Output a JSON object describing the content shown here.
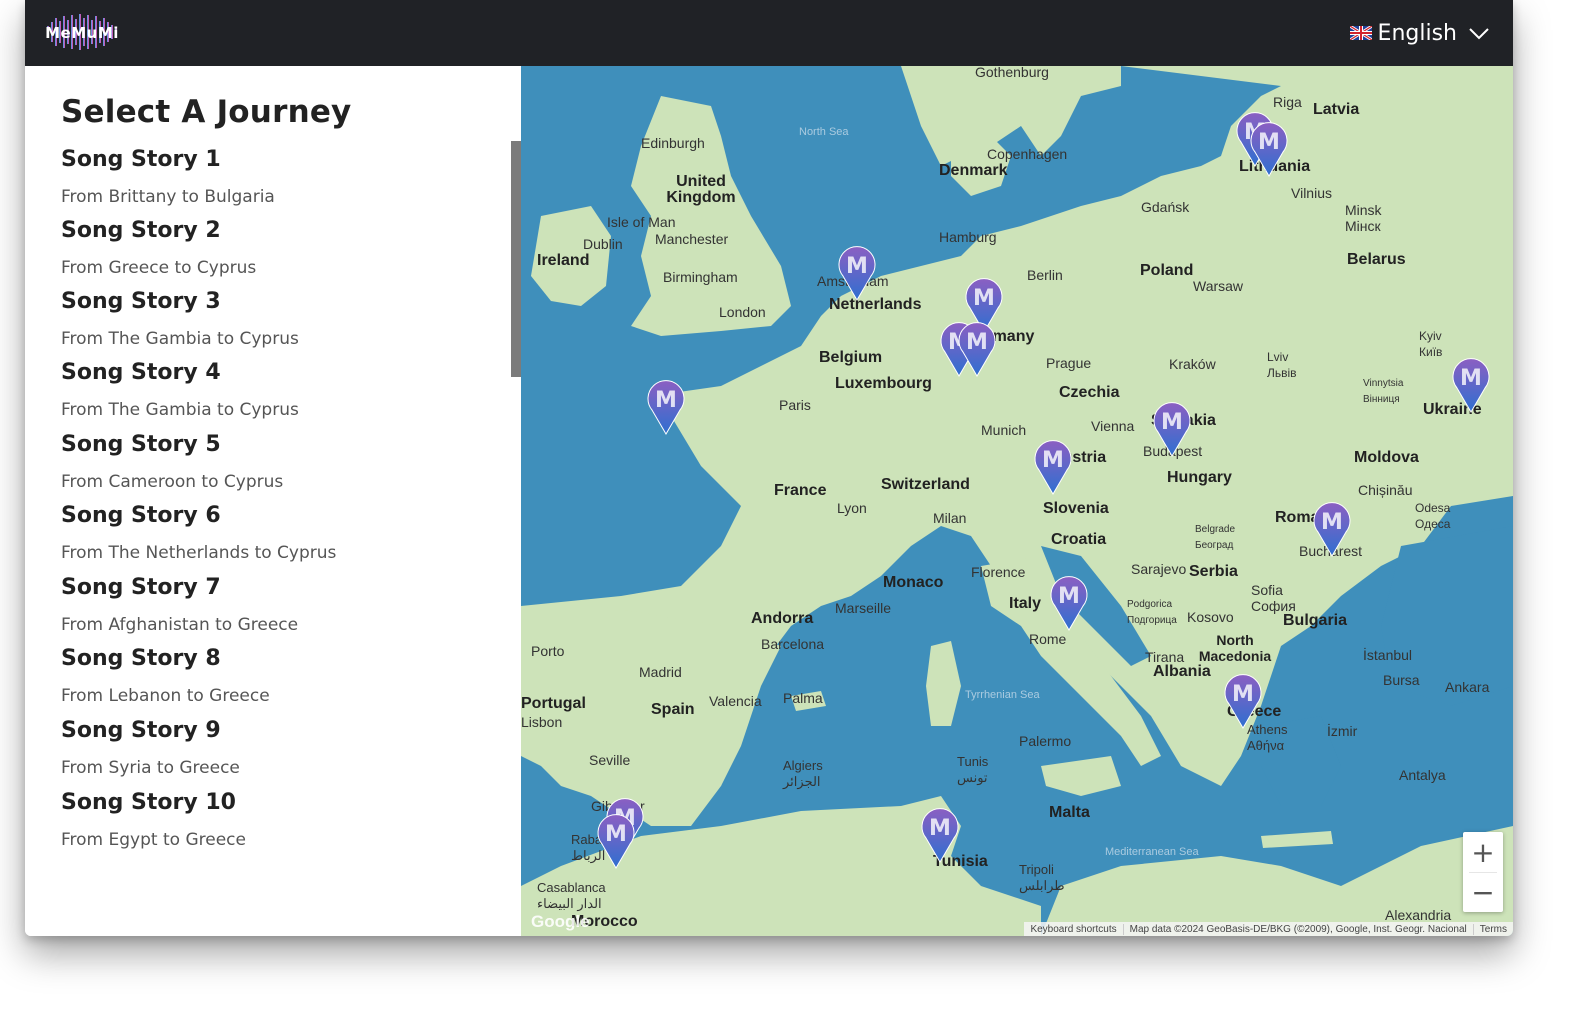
{
  "app": {
    "logo_text": "MeMuMi"
  },
  "header": {
    "language_label": "English"
  },
  "sidebar": {
    "title": "Select A Journey",
    "stories": [
      {
        "title": "Song Story 1",
        "route": "From Brittany to Bulgaria"
      },
      {
        "title": "Song Story 2",
        "route": "From Greece to Cyprus"
      },
      {
        "title": "Song Story 3",
        "route": "From The Gambia to Cyprus"
      },
      {
        "title": "Song Story 4",
        "route": "From The Gambia to Cyprus"
      },
      {
        "title": "Song Story 5",
        "route": "From Cameroon to Cyprus"
      },
      {
        "title": "Song Story 6",
        "route": "From The Netherlands to Cyprus"
      },
      {
        "title": "Song Story 7",
        "route": "From Afghanistan to Greece"
      },
      {
        "title": "Song Story 8",
        "route": "From Lebanon to Greece"
      },
      {
        "title": "Song Story 9",
        "route": "From Syria to Greece"
      },
      {
        "title": "Song Story 10",
        "route": "From Egypt to Greece"
      }
    ]
  },
  "map": {
    "marker_letter": "M",
    "labels": {
      "gothenburg": "Gothenburg",
      "riga": "Riga",
      "latvia": "Latvia",
      "north_sea": "North Sea",
      "edinburgh": "Edinburgh",
      "uk": "United Kingdom",
      "copenhagen": "Copenhagen",
      "denmark": "Denmark",
      "lithuania": "Lithuania",
      "vilnius": "Vilnius",
      "gdansk": "Gdańsk",
      "minsk": "Minsk Мінск",
      "isle_of_man": "Isle of Man",
      "dublin": "Dublin",
      "manchester": "Manchester",
      "ireland": "Ireland",
      "hamburg": "Hamburg",
      "birmingham": "Birmingham",
      "amsterdam": "Amsterdam",
      "netherlands": "Netherlands",
      "berlin": "Berlin",
      "poland": "Poland",
      "warsaw": "Warsaw",
      "belarus": "Belarus",
      "london": "London",
      "germany": "Germany",
      "belgium": "Belgium",
      "prague": "Prague",
      "krakow": "Kraków",
      "lviv": "Lviv Львів",
      "kyiv": "Kyiv Київ",
      "luxembourg": "Luxembourg",
      "czechia": "Czechia",
      "vinnytsia": "Vinnytsia Вінниця",
      "ukraine": "Ukraine",
      "paris": "Paris",
      "munich": "Munich",
      "vienna": "Vienna",
      "slovakia": "Slovakia",
      "budapest": "Budapest",
      "austria": "Austria",
      "moldova": "Moldova",
      "chisinau": "Chișinău",
      "france": "France",
      "switzerland": "Switzerland",
      "hungary": "Hungary",
      "odesa": "Odesa Одеса",
      "lyon": "Lyon",
      "milan": "Milan",
      "slovenia": "Slovenia",
      "belgrade": "Belgrade Београд",
      "romania": "Romania",
      "croatia": "Croatia",
      "bucharest": "Bucharest",
      "monaco": "Monaco",
      "florence": "Florence",
      "sarajevo": "Sarajevo",
      "serbia": "Serbia",
      "sofia": "Sofia София",
      "andorra": "Andorra",
      "marseille": "Marseille",
      "italy": "Italy",
      "podgorica": "Podgorica Подгорица",
      "kosovo": "Kosovo",
      "bulgaria": "Bulgaria",
      "barcelona": "Barcelona",
      "rome": "Rome",
      "north_macedonia": "North Macedonia",
      "istanbul": "İstanbul",
      "porto": "Porto",
      "madrid": "Madrid",
      "tirana": "Tirana",
      "albania": "Albania",
      "bursa": "Bursa",
      "ankara": "Ankara",
      "portugal": "Portugal",
      "valencia": "Valencia",
      "palma": "Palma",
      "spain": "Spain",
      "lisbon": "Lisbon",
      "tyrrhenian": "Tyrrhenian Sea",
      "greece": "Greece",
      "athens": "Athens Αθήνα",
      "izmir": "İzmir",
      "palermo": "Palermo",
      "seville": "Seville",
      "algiers": "Algiers الجزائر",
      "tunis": "Tunis تونس",
      "antalya": "Antalya",
      "gibraltar": "Gibraltar",
      "malta": "Malta",
      "rabat": "Rabat الرباط",
      "tunisia": "Tunisia",
      "mediterranean": "Mediterranean Sea",
      "tripoli": "Tripoli طرابلس",
      "casablanca": "Casablanca الدار البيضاء",
      "morocco": "Morocco",
      "alexandria": "Alexandria"
    },
    "controls": {
      "zoom_in": "+",
      "zoom_out": "−"
    },
    "attribution": {
      "shortcuts": "Keyboard shortcuts",
      "data": "Map data ©2024 GeoBasis-DE/BKG (©2009), Google, Inst. Geogr. Nacional",
      "terms": "Terms",
      "google": "Google"
    }
  }
}
